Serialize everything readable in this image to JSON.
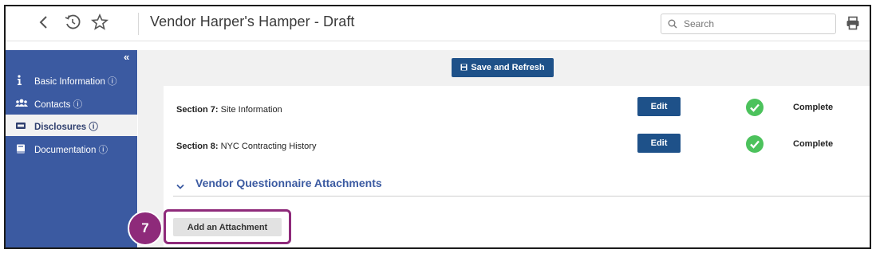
{
  "header": {
    "title": "Vendor Harper's Hamper - Draft",
    "search_placeholder": "Search",
    "icons": [
      "back-icon",
      "history-icon",
      "star-icon",
      "search-icon",
      "print-icon"
    ]
  },
  "sidebar": {
    "collapse_label": "«",
    "items": [
      {
        "label": "Basic Information ⓘ",
        "icon": "info-icon",
        "active": false
      },
      {
        "label": "Contacts ⓘ",
        "icon": "users-icon",
        "active": false
      },
      {
        "label": "Disclosures ⓘ",
        "icon": "id-card-icon",
        "active": true
      },
      {
        "label": "Documentation ⓘ",
        "icon": "book-icon",
        "active": false
      }
    ]
  },
  "toolbar": {
    "save_label": "Save and Refresh"
  },
  "sections": [
    {
      "prefix": "Section 7:",
      "name": "Site Information",
      "edit_label": "Edit",
      "status": "Complete"
    },
    {
      "prefix": "Section 8:",
      "name": "NYC Contracting History",
      "edit_label": "Edit",
      "status": "Complete"
    }
  ],
  "attachments": {
    "title": "Vendor Questionnaire Attachments",
    "add_label": "Add an Attachment"
  },
  "annotation": {
    "step": "7"
  },
  "colors": {
    "primary": "#1e5189",
    "sidebar": "#3b5aa1",
    "success": "#4cc25c",
    "highlight": "#8e2a7a"
  }
}
